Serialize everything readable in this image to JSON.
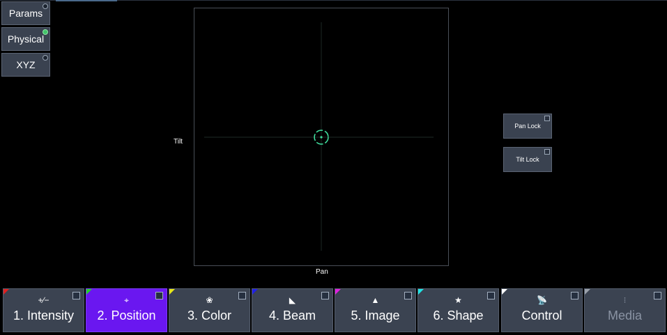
{
  "modes": [
    {
      "label": "Params",
      "active": false
    },
    {
      "label": "Physical",
      "active": true
    },
    {
      "label": "XYZ",
      "active": false
    }
  ],
  "plot": {
    "x_axis_label": "Pan",
    "y_axis_label": "Tilt",
    "cursor_color": "#3fdc9c"
  },
  "locks": {
    "pan_lock": "Pan Lock",
    "tilt_lock": "Tilt Lock"
  },
  "tabs": [
    {
      "label": "1. Intensity",
      "icon": "intensity-icon",
      "color": "#e02020",
      "active": false,
      "dim": false
    },
    {
      "label": "2. Position",
      "icon": "position-icon",
      "color": "#22d22a",
      "active": true,
      "dim": false
    },
    {
      "label": "3. Color",
      "icon": "color-icon",
      "color": "#e6e61a",
      "active": false,
      "dim": false
    },
    {
      "label": "4. Beam",
      "icon": "beam-icon",
      "color": "#2020e6",
      "active": false,
      "dim": false
    },
    {
      "label": "5. Image",
      "icon": "image-icon",
      "color": "#e020e0",
      "active": false,
      "dim": false
    },
    {
      "label": "6. Shape",
      "icon": "shape-icon",
      "color": "#20e6e6",
      "active": false,
      "dim": false
    },
    {
      "label": "Control",
      "icon": "control-icon",
      "color": "#ffffff",
      "active": false,
      "dim": false
    },
    {
      "label": "Media",
      "icon": "media-icon",
      "color": "#9aa0aa",
      "active": false,
      "dim": true
    }
  ]
}
